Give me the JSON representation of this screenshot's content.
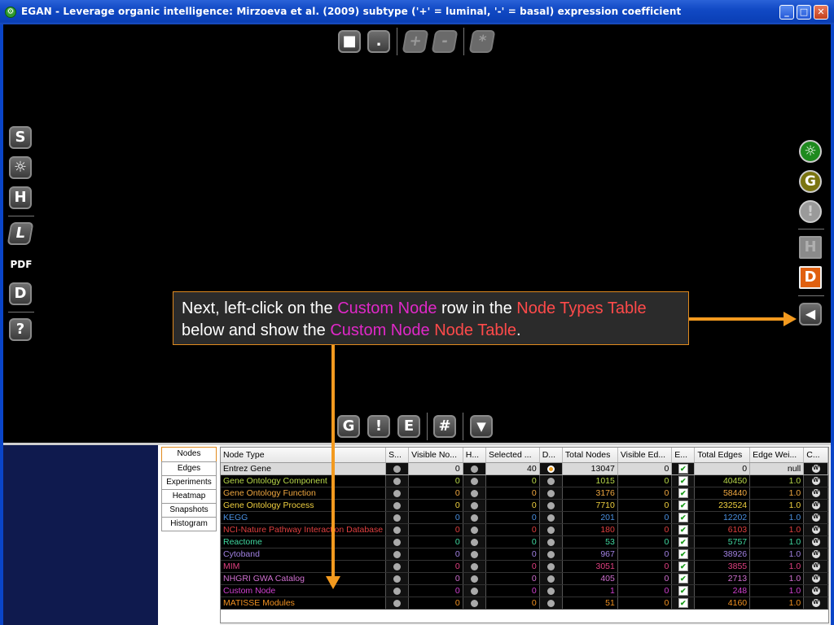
{
  "window": {
    "title": "EGAN - Leverage organic intelligence: Mirzoeva et al. (2009) subtype ('+' = luminal, '-' = basal) expression coefficient",
    "controls": {
      "minimize": "_",
      "maximize": "□",
      "close": "✕"
    }
  },
  "top_toolbar": [
    "■",
    ".",
    "+",
    "-",
    "*"
  ],
  "left_toolbar": [
    "S",
    "☼",
    "H",
    "L",
    "PDF",
    "D",
    "?"
  ],
  "right_toolbar": [
    "☼",
    "G",
    "!",
    "H",
    "D",
    "◀"
  ],
  "bottom_toolbar": [
    "G",
    "!",
    "E",
    "#",
    "▼"
  ],
  "callout": {
    "p1": "Next, left-click on the ",
    "h1": "Custom Node",
    "p2": " row in the ",
    "h2": "Node Types Table",
    "p3": " below and show the ",
    "h3": "Custom Node",
    "p4": " ",
    "h4": "Node Table",
    "p5": "."
  },
  "tabs": [
    "Nodes",
    "Edges",
    "Experiments",
    "Heatmap",
    "Snapshots",
    "Histogram"
  ],
  "table": {
    "headers": [
      "Node Type",
      "S...",
      "Visible No...",
      "H...",
      "Selected ...",
      "D...",
      "Total Nodes",
      "Visible Ed...",
      "E...",
      "Total Edges",
      "Edge Wei...",
      "C..."
    ],
    "rows": [
      {
        "name": "Entrez Gene",
        "color": "#000000",
        "visible": "0",
        "selected": "40",
        "total": "13047",
        "visible_edges": "0",
        "total_edges": "0",
        "weight": "null"
      },
      {
        "name": "Gene Ontology Component",
        "color": "#b8d84a",
        "visible": "0",
        "selected": "0",
        "total": "1015",
        "visible_edges": "0",
        "total_edges": "40450",
        "weight": "1.0"
      },
      {
        "name": "Gene Ontology Function",
        "color": "#f0a840",
        "visible": "0",
        "selected": "0",
        "total": "3176",
        "visible_edges": "0",
        "total_edges": "58440",
        "weight": "1.0"
      },
      {
        "name": "Gene Ontology Process",
        "color": "#f0d040",
        "visible": "0",
        "selected": "0",
        "total": "7710",
        "visible_edges": "0",
        "total_edges": "232524",
        "weight": "1.0"
      },
      {
        "name": "KEGG",
        "color": "#4a90e0",
        "visible": "0",
        "selected": "0",
        "total": "201",
        "visible_edges": "0",
        "total_edges": "12202",
        "weight": "1.0"
      },
      {
        "name": "NCI-Nature Pathway Interaction Database",
        "color": "#e04040",
        "visible": "0",
        "selected": "0",
        "total": "180",
        "visible_edges": "0",
        "total_edges": "6103",
        "weight": "1.0"
      },
      {
        "name": "Reactome",
        "color": "#40d8a0",
        "visible": "0",
        "selected": "0",
        "total": "53",
        "visible_edges": "0",
        "total_edges": "5757",
        "weight": "1.0"
      },
      {
        "name": "Cytoband",
        "color": "#a080e0",
        "visible": "0",
        "selected": "0",
        "total": "967",
        "visible_edges": "0",
        "total_edges": "38926",
        "weight": "1.0"
      },
      {
        "name": "MIM",
        "color": "#e04080",
        "visible": "0",
        "selected": "0",
        "total": "3051",
        "visible_edges": "0",
        "total_edges": "3855",
        "weight": "1.0"
      },
      {
        "name": "NHGRI GWA Catalog",
        "color": "#d070d0",
        "visible": "0",
        "selected": "0",
        "total": "405",
        "visible_edges": "0",
        "total_edges": "2713",
        "weight": "1.0"
      },
      {
        "name": "Custom Node",
        "color": "#d040d0",
        "visible": "0",
        "selected": "0",
        "total": "1",
        "visible_edges": "0",
        "total_edges": "248",
        "weight": "1.0"
      },
      {
        "name": "MATISSE Modules",
        "color": "#f09020",
        "visible": "0",
        "selected": "0",
        "total": "51",
        "visible_edges": "0",
        "total_edges": "4160",
        "weight": "1.0"
      }
    ]
  },
  "colors": {
    "accent_orange": "#f39a1f",
    "highlight_magenta": "#e028c8",
    "highlight_red": "#ff4a4a",
    "navy_panel": "#0f1a4e"
  }
}
